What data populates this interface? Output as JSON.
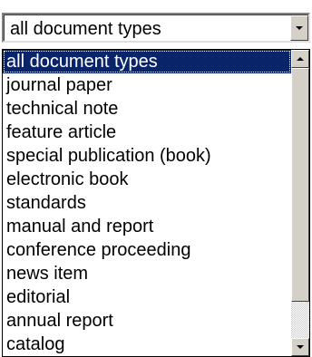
{
  "select": {
    "value": "all document types",
    "arrow_icon": "chevron-down-icon"
  },
  "list": {
    "items": [
      {
        "label": "all document types",
        "selected": true
      },
      {
        "label": "journal paper"
      },
      {
        "label": "technical note"
      },
      {
        "label": "feature article"
      },
      {
        "label": "special publication (book)"
      },
      {
        "label": "electronic book"
      },
      {
        "label": "standards"
      },
      {
        "label": "manual and report"
      },
      {
        "label": "conference proceeding"
      },
      {
        "label": "news item"
      },
      {
        "label": "editorial"
      },
      {
        "label": "annual report"
      },
      {
        "label": "catalog"
      }
    ]
  },
  "colors": {
    "highlight": "#0a246a",
    "highlight_text": "#ffffff",
    "face": "#d4d0c8"
  }
}
